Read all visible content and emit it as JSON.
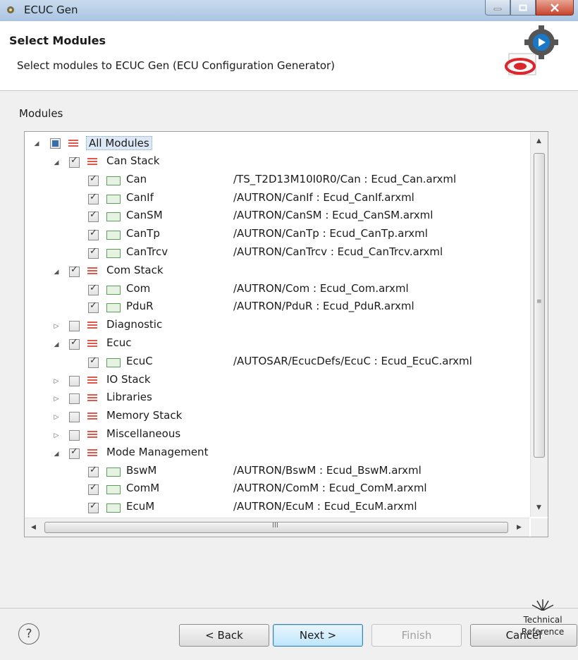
{
  "window": {
    "title": "ECUC Gen"
  },
  "header": {
    "title": "Select Modules",
    "description": "Select modules to ECUC Gen (ECU Configuration Generator)"
  },
  "modules": {
    "label": "Modules",
    "root": {
      "label": "All Modules",
      "state": "partial"
    },
    "rows": [
      {
        "level": 1,
        "type": "group",
        "expanded": true,
        "state": "checked",
        "label": "Can Stack",
        "path": ""
      },
      {
        "level": 2,
        "type": "module",
        "state": "checked",
        "label": "Can",
        "path": "/TS_T2D13M10I0R0/Can : Ecud_Can.arxml"
      },
      {
        "level": 2,
        "type": "module",
        "state": "checked",
        "label": "CanIf",
        "path": "/AUTRON/CanIf : Ecud_CanIf.arxml"
      },
      {
        "level": 2,
        "type": "module",
        "state": "checked",
        "label": "CanSM",
        "path": "/AUTRON/CanSM : Ecud_CanSM.arxml"
      },
      {
        "level": 2,
        "type": "module",
        "state": "checked",
        "label": "CanTp",
        "path": "/AUTRON/CanTp : Ecud_CanTp.arxml"
      },
      {
        "level": 2,
        "type": "module",
        "state": "checked",
        "label": "CanTrcv",
        "path": "/AUTRON/CanTrcv : Ecud_CanTrcv.arxml"
      },
      {
        "level": 1,
        "type": "group",
        "expanded": true,
        "state": "checked",
        "label": "Com Stack",
        "path": ""
      },
      {
        "level": 2,
        "type": "module",
        "state": "checked",
        "label": "Com",
        "path": "/AUTRON/Com : Ecud_Com.arxml"
      },
      {
        "level": 2,
        "type": "module",
        "state": "checked",
        "label": "PduR",
        "path": "/AUTRON/PduR : Ecud_PduR.arxml"
      },
      {
        "level": 1,
        "type": "group",
        "expanded": false,
        "state": "unchecked",
        "label": "Diagnostic",
        "path": ""
      },
      {
        "level": 1,
        "type": "group",
        "expanded": true,
        "state": "checked",
        "label": "Ecuc",
        "path": ""
      },
      {
        "level": 2,
        "type": "module",
        "state": "checked",
        "label": "EcuC",
        "path": "/AUTOSAR/EcucDefs/EcuC : Ecud_EcuC.arxml"
      },
      {
        "level": 1,
        "type": "group",
        "expanded": false,
        "state": "unchecked",
        "label": "IO Stack",
        "path": ""
      },
      {
        "level": 1,
        "type": "group",
        "expanded": false,
        "state": "unchecked",
        "label": "Libraries",
        "path": ""
      },
      {
        "level": 1,
        "type": "group",
        "expanded": false,
        "state": "unchecked",
        "label": "Memory Stack",
        "path": ""
      },
      {
        "level": 1,
        "type": "group",
        "expanded": false,
        "state": "unchecked",
        "label": "Miscellaneous",
        "path": ""
      },
      {
        "level": 1,
        "type": "group",
        "expanded": true,
        "state": "checked",
        "label": "Mode Management",
        "path": ""
      },
      {
        "level": 2,
        "type": "module",
        "state": "checked",
        "label": "BswM",
        "path": "/AUTRON/BswM : Ecud_BswM.arxml"
      },
      {
        "level": 2,
        "type": "module",
        "state": "checked",
        "label": "ComM",
        "path": "/AUTRON/ComM : Ecud_ComM.arxml"
      },
      {
        "level": 2,
        "type": "module",
        "state": "checked",
        "label": "EcuM",
        "path": "/AUTRON/EcuM : Ecud_EcuM.arxml"
      }
    ]
  },
  "hscroll": {
    "grip": "III"
  },
  "footer": {
    "help": "?",
    "back": "< Back",
    "next": "Next >",
    "finish": "Finish",
    "cancel": "Cancel"
  },
  "watermark": {
    "line1": "Technical",
    "line2": "Reference"
  }
}
